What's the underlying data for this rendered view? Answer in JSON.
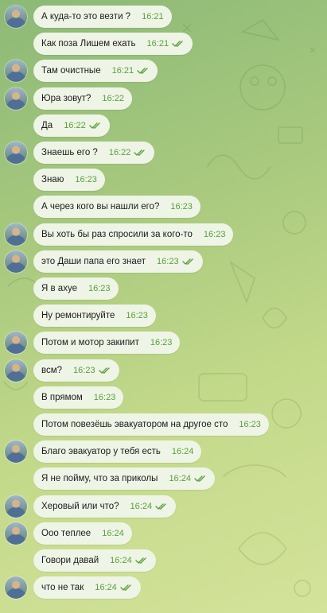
{
  "colors": {
    "bubble": "#eef5e6",
    "text": "#1b1b1b",
    "time": "#5aa03a",
    "check": "#5aa03a"
  },
  "messages": [
    {
      "text": "А куда-то это везти ?",
      "time": "16:21",
      "avatar": true,
      "read": false
    },
    {
      "text": "Как поза Лишем ехать",
      "time": "16:21",
      "avatar": false,
      "read": true
    },
    {
      "text": "Там очистные",
      "time": "16:21",
      "avatar": true,
      "read": true
    },
    {
      "text": "Юра зовут?",
      "time": "16:22",
      "avatar": true,
      "read": false
    },
    {
      "text": "Да",
      "time": "16:22",
      "avatar": false,
      "read": true
    },
    {
      "text": "Знаешь его ?",
      "time": "16:22",
      "avatar": true,
      "read": true
    },
    {
      "text": "Знаю",
      "time": "16:23",
      "avatar": false,
      "read": false
    },
    {
      "text": "А через кого вы нашли его?",
      "time": "16:23",
      "avatar": false,
      "read": false
    },
    {
      "text": "Вы хоть бы раз спросили за кого-то",
      "time": "16:23",
      "avatar": true,
      "read": false
    },
    {
      "text": "это Даши папа его знает",
      "time": "16:23",
      "avatar": true,
      "read": true
    },
    {
      "text": "Я в ахуе",
      "time": "16:23",
      "avatar": false,
      "read": false
    },
    {
      "text": "Ну ремонтируйте",
      "time": "16:23",
      "avatar": false,
      "read": false
    },
    {
      "text": "Потом и мотор закипит",
      "time": "16:23",
      "avatar": true,
      "read": false
    },
    {
      "text": "всм?",
      "time": "16:23",
      "avatar": true,
      "read": true
    },
    {
      "text": "В прямом",
      "time": "16:23",
      "avatar": false,
      "read": false
    },
    {
      "text": "Потом повезёшь эвакуатором на другое сто",
      "time": "16:23",
      "avatar": false,
      "read": false
    },
    {
      "text": "Благо эвакуатор у тебя есть",
      "time": "16:24",
      "avatar": true,
      "read": false
    },
    {
      "text": "Я не пойму, что за приколы",
      "time": "16:24",
      "avatar": false,
      "read": true
    },
    {
      "text": "Херовый или что?",
      "time": "16:24",
      "avatar": true,
      "read": true
    },
    {
      "text": "Ооо теплее",
      "time": "16:24",
      "avatar": true,
      "read": false
    },
    {
      "text": "Говори давай",
      "time": "16:24",
      "avatar": false,
      "read": true
    },
    {
      "text": "что не так",
      "time": "16:24",
      "avatar": true,
      "read": true
    }
  ]
}
